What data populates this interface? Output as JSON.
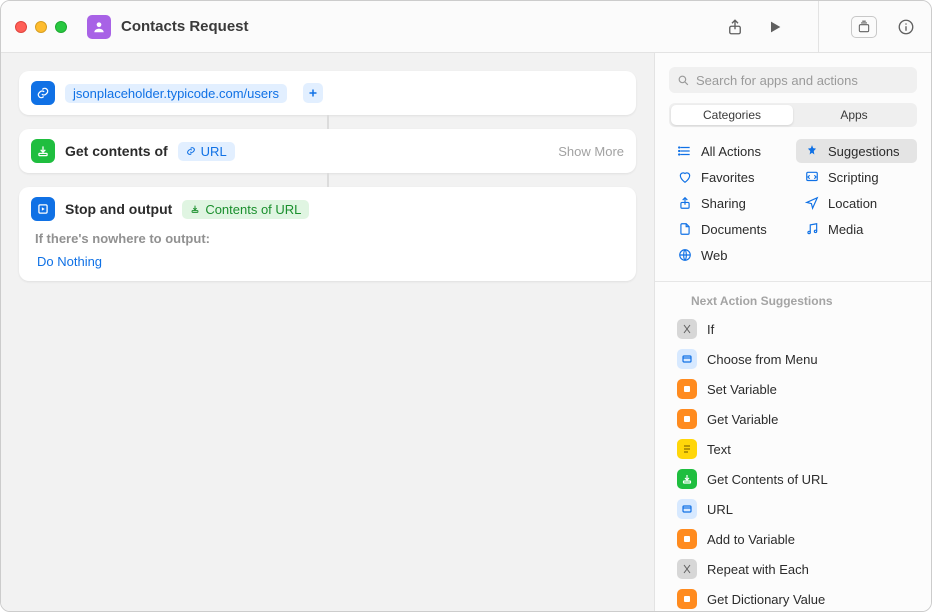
{
  "title": "Contacts Request",
  "titlebar": {
    "share_label": "Share",
    "run_label": "Run",
    "library_label": "Library",
    "info_label": "Info"
  },
  "actions": {
    "url": {
      "value": "jsonplaceholder.typicode.com/users"
    },
    "get_contents": {
      "label": "Get contents of",
      "token": "URL",
      "show_more": "Show More"
    },
    "stop_output": {
      "label": "Stop and output",
      "token": "Contents of URL",
      "sublabel": "If there's nowhere to output:",
      "option": "Do Nothing"
    }
  },
  "search": {
    "placeholder": "Search for apps and actions"
  },
  "segment": {
    "categories": "Categories",
    "apps": "Apps"
  },
  "categories": [
    {
      "key": "all",
      "label": "All Actions"
    },
    {
      "key": "suggestions",
      "label": "Suggestions",
      "selected": true
    },
    {
      "key": "favorites",
      "label": "Favorites"
    },
    {
      "key": "scripting",
      "label": "Scripting"
    },
    {
      "key": "sharing",
      "label": "Sharing"
    },
    {
      "key": "location",
      "label": "Location"
    },
    {
      "key": "documents",
      "label": "Documents"
    },
    {
      "key": "media",
      "label": "Media"
    },
    {
      "key": "web",
      "label": "Web"
    }
  ],
  "suggestions_header": "Next Action Suggestions",
  "suggestions": [
    {
      "label": "If",
      "color": "gray"
    },
    {
      "label": "Choose from Menu",
      "color": "lblue"
    },
    {
      "label": "Set Variable",
      "color": "orange"
    },
    {
      "label": "Get Variable",
      "color": "orange"
    },
    {
      "label": "Text",
      "color": "yellow"
    },
    {
      "label": "Get Contents of URL",
      "color": "green"
    },
    {
      "label": "URL",
      "color": "lblue"
    },
    {
      "label": "Add to Variable",
      "color": "orange"
    },
    {
      "label": "Repeat with Each",
      "color": "gray"
    },
    {
      "label": "Get Dictionary Value",
      "color": "orange"
    }
  ]
}
